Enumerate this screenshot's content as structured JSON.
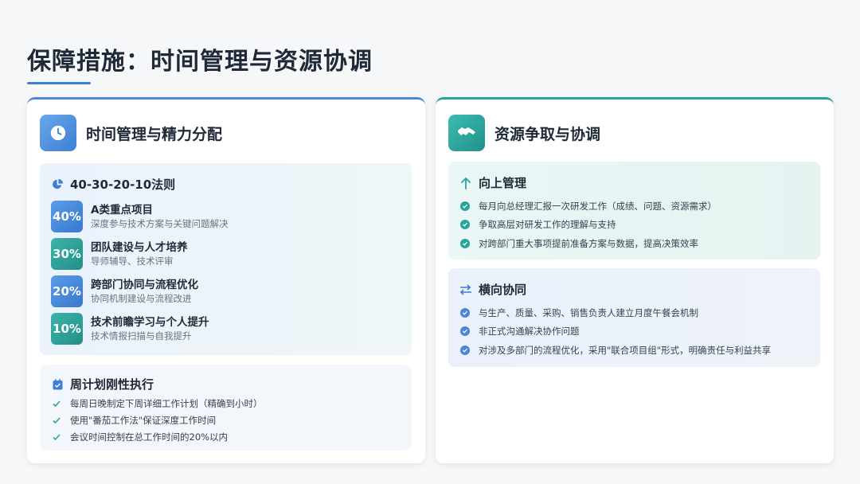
{
  "page": {
    "title": "保障措施：时间管理与资源协调"
  },
  "left": {
    "title": "时间管理与精力分配",
    "rule": {
      "heading": "40-30-20-10法则",
      "items": [
        {
          "percent": "40%",
          "name": "A类重点项目",
          "desc": "深度参与技术方案与关键问题解决"
        },
        {
          "percent": "30%",
          "name": "团队建设与人才培养",
          "desc": "导师辅导、技术评审"
        },
        {
          "percent": "20%",
          "name": "跨部门协同与流程优化",
          "desc": "协同机制建设与流程改进"
        },
        {
          "percent": "10%",
          "name": "技术前瞻学习与个人提升",
          "desc": "技术情报扫描与自我提升"
        }
      ]
    },
    "week": {
      "heading": "周计划刚性执行",
      "items": [
        "每周日晚制定下周详细工作计划（精确到小时）",
        "使用\"番茄工作法\"保证深度工作时间",
        "会议时间控制在总工作时间的20%以内"
      ]
    }
  },
  "right": {
    "title": "资源争取与协调",
    "up": {
      "heading": "向上管理",
      "items": [
        "每月向总经理汇报一次研发工作（成绩、问题、资源需求）",
        "争取高层对研发工作的理解与支持",
        "对跨部门重大事项提前准备方案与数据，提高决策效率"
      ]
    },
    "side": {
      "heading": "横向协同",
      "items": [
        "与生产、质量、采购、销售负责人建立月度午餐会机制",
        "非正式沟通解决协作问题",
        "对涉及多部门的流程优化，采用\"联合项目组\"形式，明确责任与利益共享"
      ]
    }
  },
  "colors": {
    "blue": "#3d7fd4",
    "teal": "#2aa39a"
  }
}
